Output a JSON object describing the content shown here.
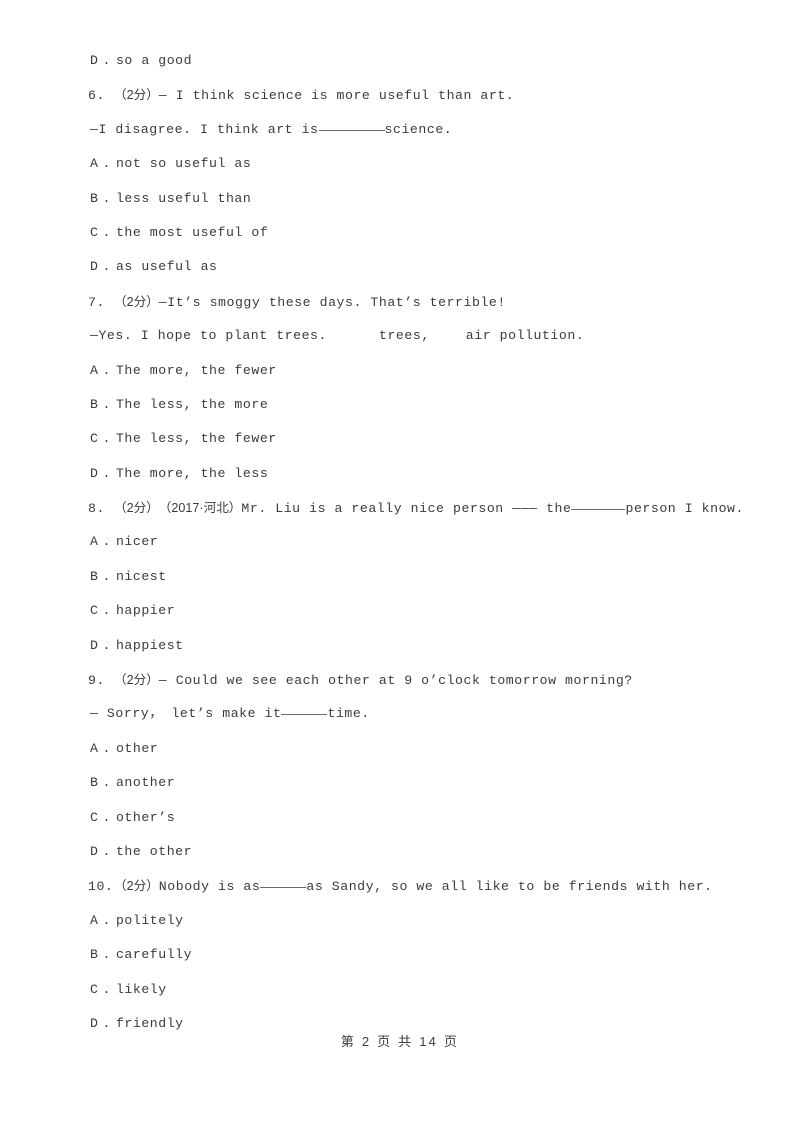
{
  "document": {
    "type": "exam-paper",
    "language": "en-zh",
    "text_color": "#3b3b3b",
    "background_color": "#ffffff"
  },
  "orphan_option": {
    "label": "D",
    "separator": ".",
    "text": "so a good"
  },
  "questions": [
    {
      "number": "6.",
      "marks": "（2分）",
      "source": "",
      "stem_parts": [
        "— I think science is more useful than art."
      ],
      "continuation": {
        "before": "—I disagree. I think art is",
        "blank": "long",
        "after": "science."
      },
      "options": [
        {
          "label": "A",
          "separator": ".",
          "text": "not so useful as"
        },
        {
          "label": "B",
          "separator": ".",
          "text": "less useful than"
        },
        {
          "label": "C",
          "separator": ".",
          "text": "the most useful of"
        },
        {
          "label": "D",
          "separator": ".",
          "text": "as useful as"
        }
      ]
    },
    {
      "number": "7.",
      "marks": "（2分）",
      "source": "",
      "stem_parts": [
        "—It’s smoggy these days. That’s terrible!"
      ],
      "continuation": {
        "before": "—Yes. I hope to plant trees.",
        "gap1": "",
        "middle": "trees,",
        "gap2": "",
        "after": "air pollution."
      },
      "options": [
        {
          "label": "A",
          "separator": ".",
          "text": "The more, the fewer"
        },
        {
          "label": "B",
          "separator": ".",
          "text": "The less, the more"
        },
        {
          "label": "C",
          "separator": ".",
          "text": "The less, the fewer"
        },
        {
          "label": "D",
          "separator": ".",
          "text": "The more, the less"
        }
      ]
    },
    {
      "number": "8.",
      "marks": "（2分）",
      "source": "（2017·河北）",
      "stem_before": "Mr. Liu is a really nice person ——— the",
      "stem_blank": "mid",
      "stem_after": "person I know.",
      "options": [
        {
          "label": "A",
          "separator": ".",
          "text": "nicer"
        },
        {
          "label": "B",
          "separator": ".",
          "text": "nicest"
        },
        {
          "label": "C",
          "separator": ".",
          "text": "happier"
        },
        {
          "label": "D",
          "separator": ".",
          "text": "happiest"
        }
      ]
    },
    {
      "number": "9.",
      "marks": "（2分）",
      "source": "",
      "stem_parts": [
        "— Could we see each other at 9 o’clock tomorrow morning?"
      ],
      "continuation": {
        "before": "— Sorry，  let’s make it",
        "blank": "short",
        "after": "time."
      },
      "options": [
        {
          "label": "A",
          "separator": ".",
          "text": "other"
        },
        {
          "label": "B",
          "separator": ".",
          "text": "another"
        },
        {
          "label": "C",
          "separator": ".",
          "text": "other’s"
        },
        {
          "label": "D",
          "separator": ".",
          "text": "the other"
        }
      ]
    },
    {
      "number": "10.",
      "marks": "（2分）",
      "source": "",
      "stem_before": "Nobody is as",
      "stem_blank": "short",
      "stem_after": "as Sandy, so we all like to be friends with her.",
      "options": [
        {
          "label": "A",
          "separator": ".",
          "text": "politely"
        },
        {
          "label": "B",
          "separator": ".",
          "text": "carefully"
        },
        {
          "label": "C",
          "separator": ".",
          "text": "likely"
        },
        {
          "label": "D",
          "separator": ".",
          "text": "friendly"
        }
      ]
    }
  ],
  "footer": {
    "text": "第 2 页 共 14 页"
  }
}
